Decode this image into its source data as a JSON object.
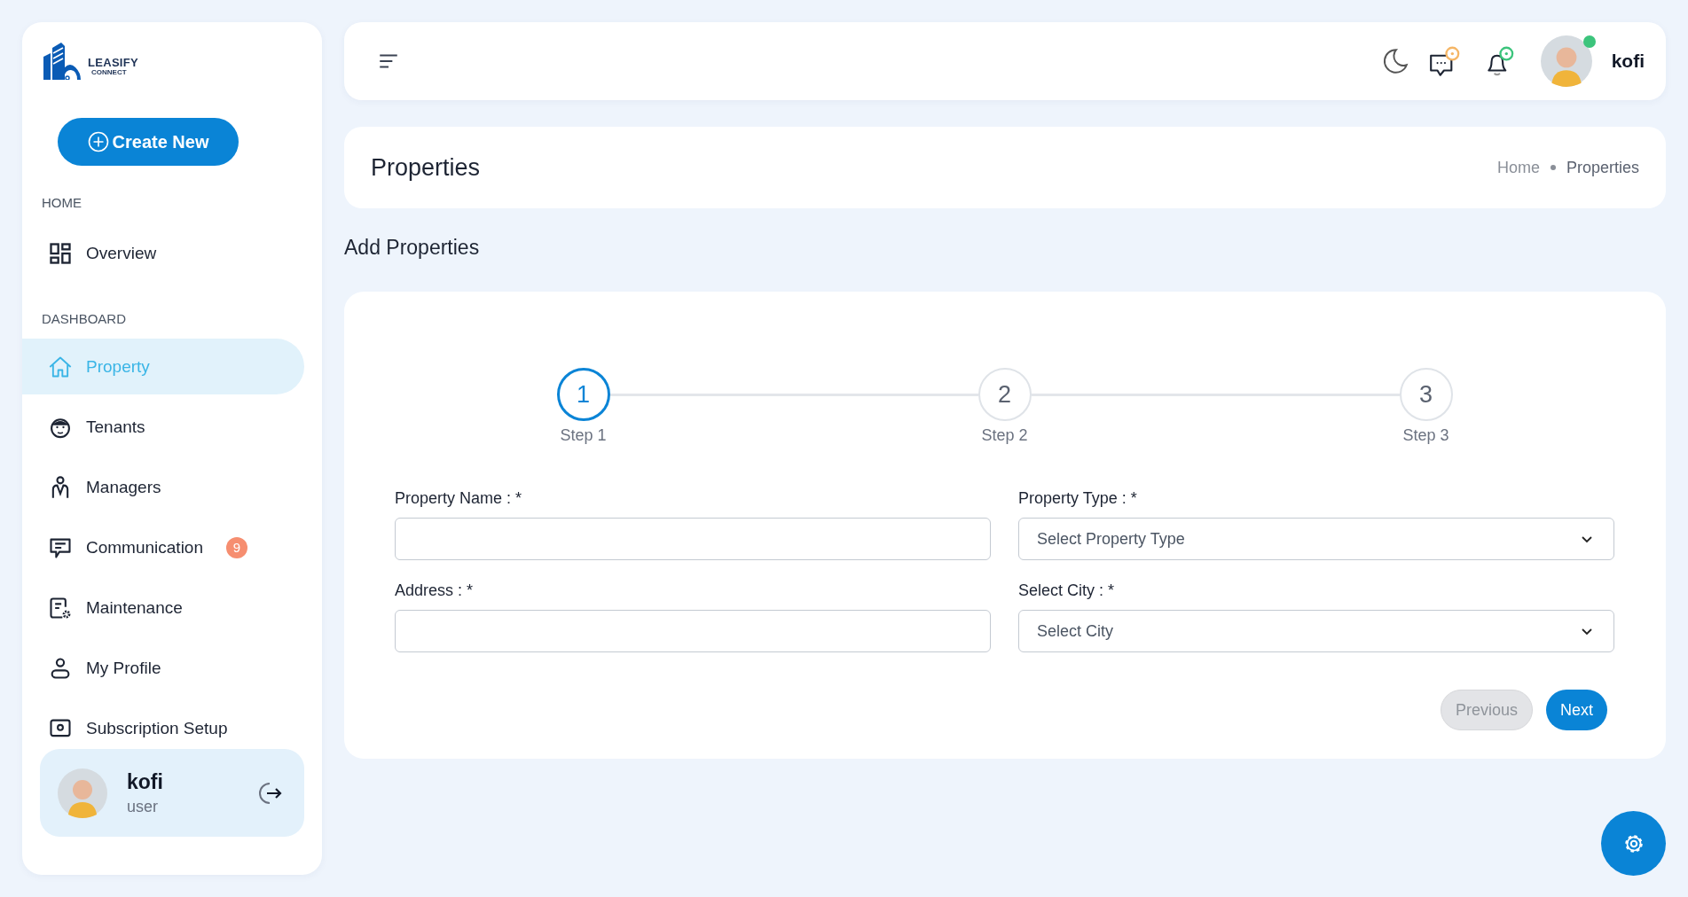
{
  "logo": {
    "name": "LEASIFY",
    "tagline": "CONNECT"
  },
  "create_button": "Create New",
  "sidebar": {
    "sections": [
      {
        "heading": "HOME",
        "items": [
          {
            "label": "Overview",
            "selected": false
          }
        ]
      },
      {
        "heading": "DASHBOARD",
        "items": [
          {
            "label": "Property",
            "selected": true
          },
          {
            "label": "Tenants",
            "selected": false
          },
          {
            "label": "Managers",
            "selected": false
          },
          {
            "label": "Communication",
            "selected": false,
            "badge": "9"
          },
          {
            "label": "Maintenance",
            "selected": false
          },
          {
            "label": "My Profile",
            "selected": false
          },
          {
            "label": "Subscription Setup",
            "selected": false
          }
        ]
      }
    ]
  },
  "user_card": {
    "name": "kofi",
    "role": "user"
  },
  "topbar": {
    "user_name": "kofi",
    "online": true
  },
  "page": {
    "title": "Properties",
    "breadcrumb": [
      "Home",
      "Properties"
    ]
  },
  "section_title": "Add Properties",
  "stepper": [
    {
      "number": "1",
      "label": "Step 1",
      "selected": true
    },
    {
      "number": "2",
      "label": "Step 2",
      "selected": false
    },
    {
      "number": "3",
      "label": "Step 3",
      "selected": false
    }
  ],
  "fields": [
    {
      "label": "Property Name : *",
      "kind": "text"
    },
    {
      "label": "Property Type : *",
      "kind": "select",
      "placeholder": "Select Property Type"
    },
    {
      "label": "Address : *",
      "kind": "text"
    },
    {
      "label": "Select City : *",
      "kind": "select",
      "placeholder": "Select City"
    }
  ],
  "buttons": [
    {
      "label": "Previous",
      "disabled": true
    },
    {
      "label": "Next",
      "disabled": false
    }
  ]
}
